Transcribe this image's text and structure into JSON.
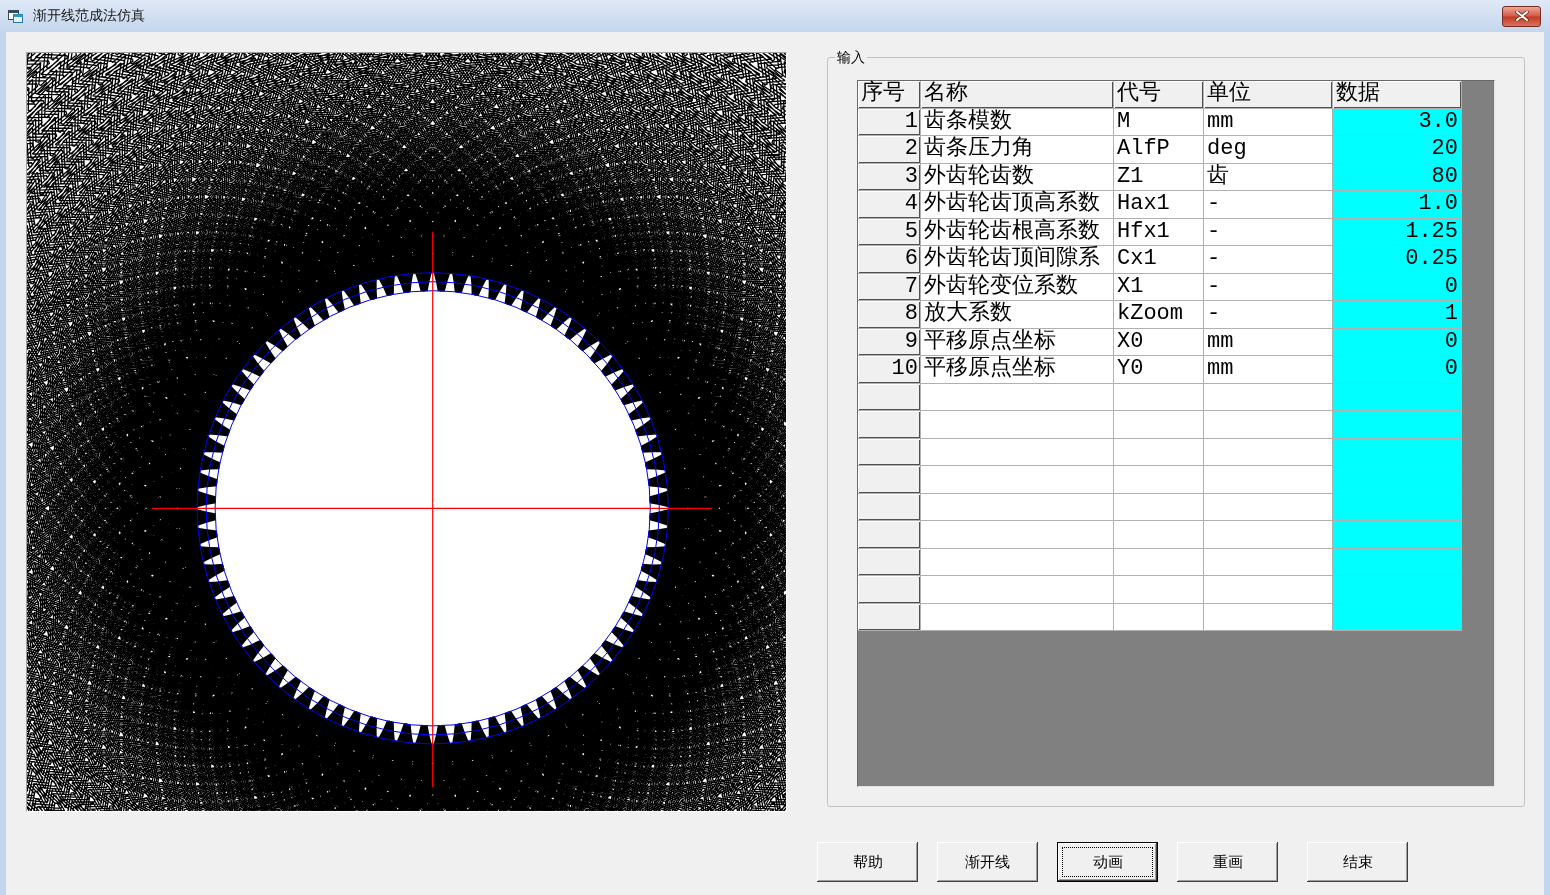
{
  "window": {
    "title": "渐开线范成法仿真"
  },
  "input_group": {
    "label": "输入",
    "table": {
      "columns": [
        "序号",
        "名称",
        "代号",
        "单位",
        "数据"
      ],
      "rows": [
        {
          "no": "1",
          "name": "齿条模数",
          "symbol": "M",
          "unit": "mm",
          "value": "3.0"
        },
        {
          "no": "2",
          "name": "齿条压力角",
          "symbol": "AlfP",
          "unit": "deg",
          "value": "20"
        },
        {
          "no": "3",
          "name": "外齿轮齿数",
          "symbol": "Z1",
          "unit": "齿",
          "value": "80"
        },
        {
          "no": "4",
          "name": "外齿轮齿顶高系数",
          "symbol": "Hax1",
          "unit": "-",
          "value": "1.0"
        },
        {
          "no": "5",
          "name": "外齿轮齿根高系数",
          "symbol": "Hfx1",
          "unit": "-",
          "value": "1.25"
        },
        {
          "no": "6",
          "name": "外齿轮齿顶间隙系",
          "symbol": "Cx1",
          "unit": "-",
          "value": "0.25"
        },
        {
          "no": "7",
          "name": "外齿轮变位系数",
          "symbol": "X1",
          "unit": "-",
          "value": "0"
        },
        {
          "no": "8",
          "name": "放大系数",
          "symbol": "kZoom",
          "unit": "-",
          "value": "1"
        },
        {
          "no": "9",
          "name": "平移原点坐标",
          "symbol": "X0",
          "unit": "mm",
          "value": "0"
        },
        {
          "no": "10",
          "name": "平移原点坐标",
          "symbol": "Y0",
          "unit": "mm",
          "value": "0"
        }
      ]
    }
  },
  "buttons": [
    {
      "label": "帮助",
      "focused": false
    },
    {
      "label": "渐开线",
      "focused": false
    },
    {
      "label": "动画",
      "focused": true
    },
    {
      "label": "重画",
      "focused": false
    },
    {
      "label": "结束",
      "focused": false
    }
  ]
}
